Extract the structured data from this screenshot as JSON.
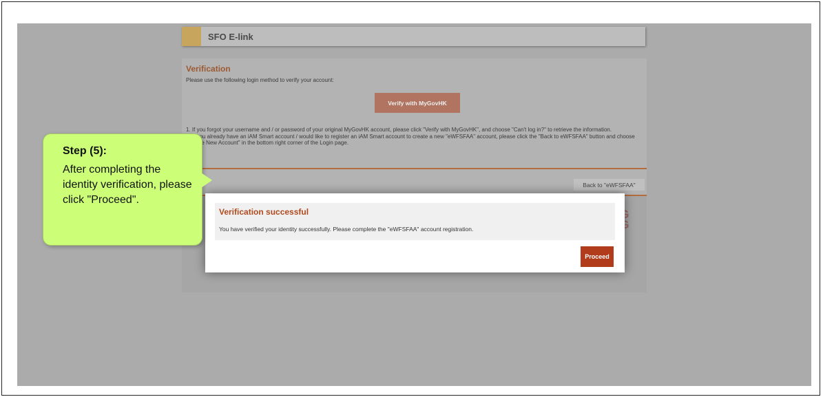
{
  "app": {
    "header_title": "SFO E-link"
  },
  "verification": {
    "title": "Verification",
    "description": "Please use the following login method to verify your account:",
    "verify_button_label": "Verify with MyGovHK",
    "note_1": "1. If you forgot your username and / or password of your original MyGovHK account, please click \"Verify with MyGovHK\", and choose \"Can't log in?\" to retrieve the information.",
    "note_2": "2. If you already have an iAM Smart account / would like to register an iAM Smart account to create a new \"eWFSFAA\" account, please click the \"Back to eWFSFAA\" button and choose \"Create New Account\" in the bottom right corner of the Login page.",
    "back_button_label": "Back to \"eWFSFAA\""
  },
  "logo_fragment": "NG\nNG",
  "dialog": {
    "title": "Verification successful",
    "message": "You have verified your identity successfully. Please complete the \"eWFSFAA\" account registration.",
    "proceed_label": "Proceed"
  },
  "callout": {
    "step": "Step (5):",
    "text": "After completing the identity verification, please click \"Proceed\"."
  },
  "colors": {
    "dialog_title": "#b04a1e",
    "proceed_button": "#b03c1c",
    "callout_bg": "#ccff77",
    "header_accent": "#c8a55c"
  }
}
